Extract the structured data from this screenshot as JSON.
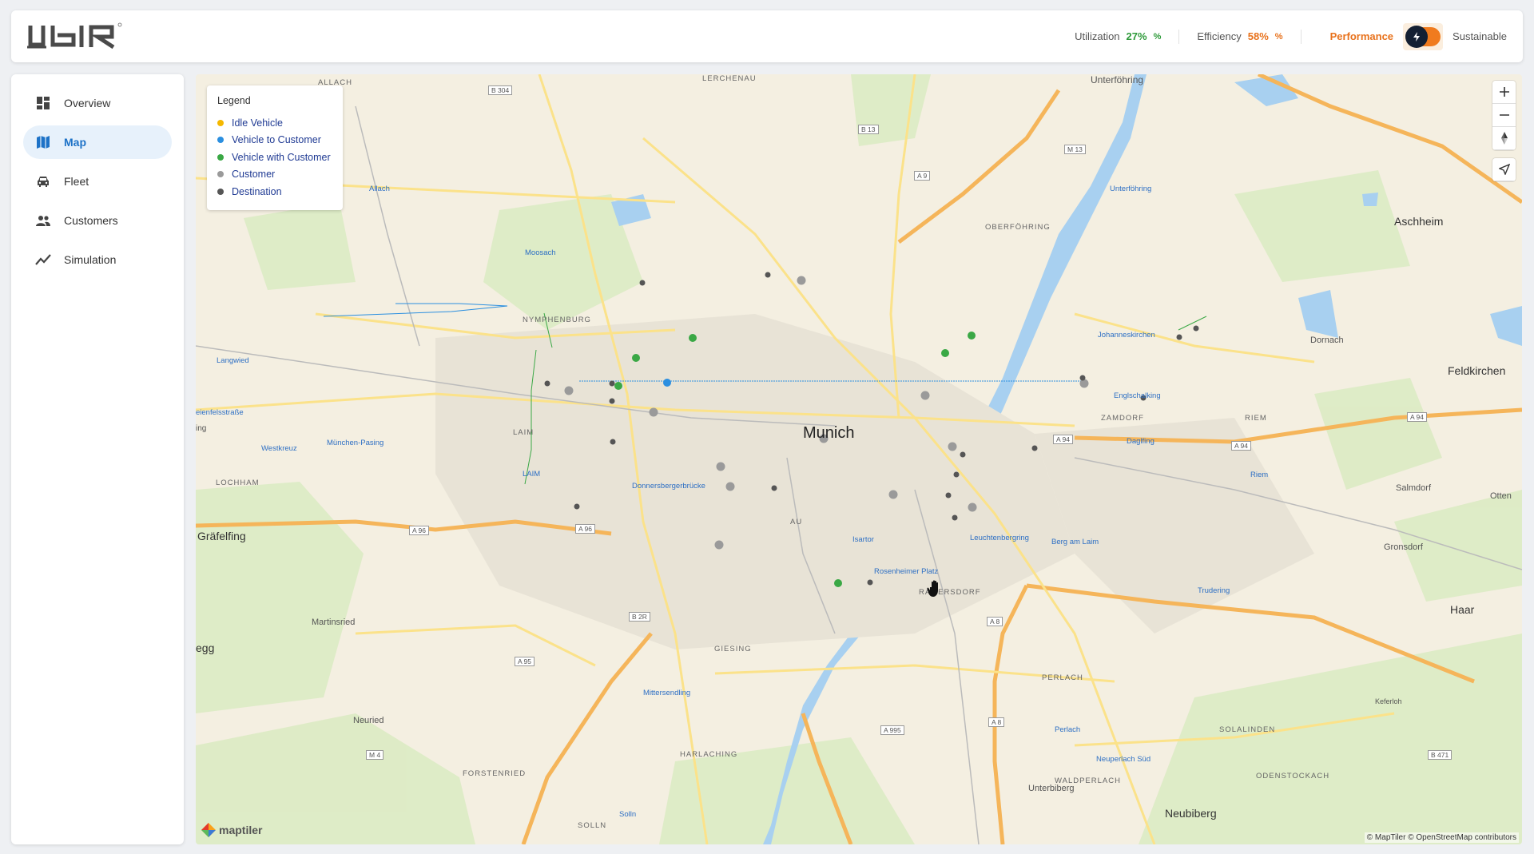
{
  "header": {
    "logo_text": "UBIR",
    "utilization": {
      "label": "Utilization",
      "value": "27%",
      "unit": "%"
    },
    "efficiency": {
      "label": "Efficiency",
      "value": "58%",
      "unit": "%"
    },
    "mode_left": "Performance",
    "mode_right": "Sustainable"
  },
  "sidebar": {
    "items": [
      {
        "label": "Overview",
        "icon": "dashboard-icon"
      },
      {
        "label": "Map",
        "icon": "map-icon"
      },
      {
        "label": "Fleet",
        "icon": "car-icon"
      },
      {
        "label": "Customers",
        "icon": "people-icon"
      },
      {
        "label": "Simulation",
        "icon": "trend-icon"
      }
    ]
  },
  "legend": {
    "title": "Legend",
    "items": [
      {
        "label": "Idle Vehicle",
        "color": "#f5b800"
      },
      {
        "label": "Vehicle to Customer",
        "color": "#2b8fe0"
      },
      {
        "label": "Vehicle with Customer",
        "color": "#3aa845"
      },
      {
        "label": "Customer",
        "color": "#9a9a9a"
      },
      {
        "label": "Destination",
        "color": "#555555"
      }
    ]
  },
  "map": {
    "city": "Munich",
    "labels": {
      "allach": "ALLACH",
      "lerchenau": "LERCHENAU",
      "unterfohring": "Unterföhring",
      "nymphenburg": "NYMPHENBURG",
      "laim": "LAIM",
      "lochham": "LOCHHAM",
      "grafelfing": "Gräfelfing",
      "martinsried": "Martinsried",
      "neuried": "Neuried",
      "forstenried": "FORSTENRIED",
      "solln": "SOLLN",
      "harlaching": "HARLACHING",
      "giesing": "GIESING",
      "au": "AU",
      "ramersdorf": "RAMERSDORF",
      "perlach": "PERLACH",
      "waldperlach": "WALDPERLACH",
      "oberfohring": "OBERFÖHRING",
      "zamdorf": "ZAMDORF",
      "riem": "RIEM",
      "aschheim": "Aschheim",
      "dornach": "Dornach",
      "feldkirchen": "Feldkirchen",
      "salmdorf": "Salmdorf",
      "gronsdorf": "Gronsdorf",
      "haar": "Haar",
      "neubiberg": "Neubiberg",
      "unterbiberg": "Unterbiberg",
      "oedenstockach": "ODENSTOCKACH",
      "sulinden": "SOLALINDEN",
      "keferloh": "Keferloh",
      "moosach": "Moosach",
      "langwied": "Langwied",
      "pasing": "München-Pasing",
      "westkreuz": "Westkreuz",
      "donnersberger": "Donnersbergerbrücke",
      "isartor": "Isartor",
      "rosenheimer": "Rosenheimer Platz",
      "leuchtenberg": "Leuchtenbergring",
      "bergamlaim": "Berg am Laim",
      "trudering": "Trudering",
      "englschalking": "Englschalking",
      "dagfing": "Daglfing",
      "johanneskirchen": "Johanneskirchen",
      "mittersendling": "Mittersendling",
      "perlach_st": "Perlach",
      "neuperlach": "Neuperlach Süd",
      "allach_st": "Allach",
      "unterfohring_st": "Unterföhring",
      "riem_st": "Riem",
      "solln_st": "Solln",
      "eienfels": "eienfelsstraße",
      "a96": "A 96",
      "a94": "A 94",
      "a95": "A 95",
      "a8": "A 8",
      "a9": "A 9",
      "a995": "A 995",
      "b304": "B 304",
      "b13": "B 13",
      "b2r": "B 2R",
      "m4": "M 4",
      "m13": "M 13",
      "b471": "B 471",
      "ottens": "Otten",
      "egg": "egg",
      "ing": "ing"
    },
    "attribution": "© MapTiler © OpenStreetMap contributors",
    "maptiler": "maptiler"
  }
}
